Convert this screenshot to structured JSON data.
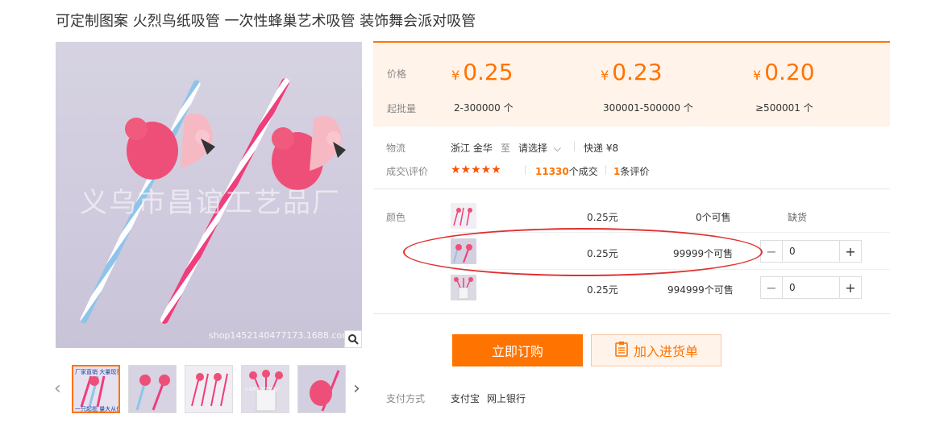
{
  "product": {
    "title": "可定制图案 火烈鸟纸吸管 一次性蜂巢艺术吸管 装饰舞会派对吸管"
  },
  "gallery": {
    "watermark": "义乌市昌谊工艺品厂",
    "shop_url": "shop1452140477173.1688.com",
    "thumb_caption_top": "厂家直销 大量现货",
    "thumb_caption_bottom": "一只起批 量大从优",
    "thumb_watermark": "义乌市昌谊工艺品厂",
    "icons": {
      "zoom": "search-icon",
      "prev": "chevron-left-icon",
      "next": "chevron-right-icon"
    }
  },
  "pricing": {
    "price_label": "价格",
    "qty_label": "起批量",
    "currency": "¥",
    "tiers": [
      {
        "price": "0.25",
        "range": "2-300000 个"
      },
      {
        "price": "0.23",
        "range": "300001-500000 个"
      },
      {
        "price": "0.20",
        "range": "≥500001 个"
      }
    ],
    "accent_color": "#ff7300"
  },
  "logistics": {
    "label": "物流",
    "origin": "浙江 金华",
    "to": "至",
    "select": "请选择",
    "shipping": "快递 ¥8"
  },
  "reviews": {
    "label": "成交\\评价",
    "stars": "★★★★★",
    "deals_count": "11330",
    "deals_text": "个成交",
    "review_count": "1",
    "review_text": "条评价"
  },
  "variants": {
    "label": "颜色",
    "items": [
      {
        "price": "0.25元",
        "stock": "0个可售",
        "status": "缺货"
      },
      {
        "price": "0.25元",
        "stock": "99999个可售",
        "quantity": "0"
      },
      {
        "price": "0.25元",
        "stock": "994999个可售",
        "quantity": "0"
      }
    ],
    "minus": "−",
    "plus": "+"
  },
  "actions": {
    "buy_now": "立即订购",
    "add_to_cart": "加入进货单"
  },
  "payment": {
    "label": "支付方式",
    "methods": [
      "支付宝",
      "网上银行"
    ]
  }
}
